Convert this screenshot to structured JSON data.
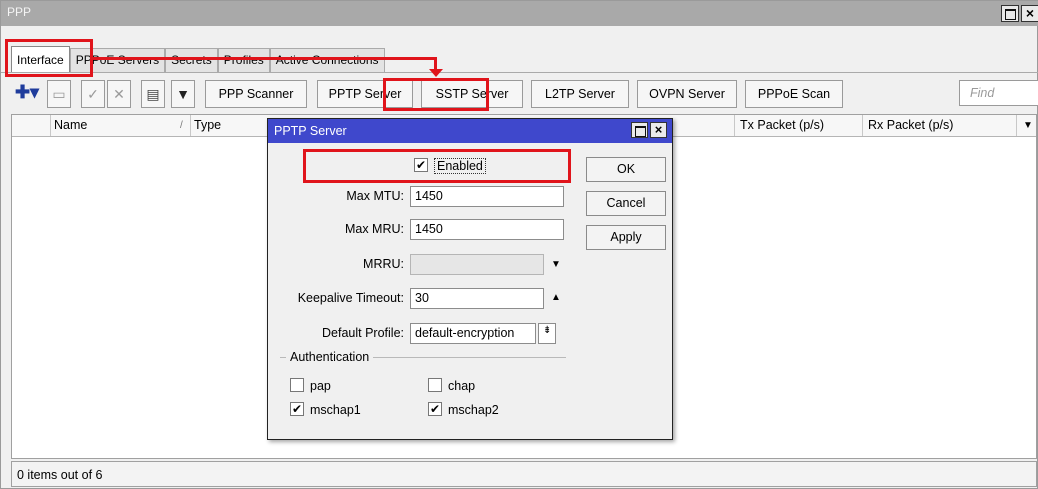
{
  "window": {
    "title": "PPP"
  },
  "tabs": [
    {
      "label": "Interface",
      "active": true
    },
    {
      "label": "PPPoE Servers",
      "active": false
    },
    {
      "label": "Secrets",
      "active": false
    },
    {
      "label": "Profiles",
      "active": false
    },
    {
      "label": "Active Connections",
      "active": false
    }
  ],
  "toolbar": {
    "icons": [
      "add-icon",
      "remove-icon",
      "enable-icon",
      "disable-icon",
      "comment-icon",
      "filter-icon"
    ],
    "buttons": [
      "PPP Scanner",
      "PPTP Server",
      "SSTP Server",
      "L2TP Server",
      "OVPN Server",
      "PPPoE Scan"
    ],
    "find_placeholder": "Find"
  },
  "table": {
    "columns": [
      "Name",
      "Type",
      "Tx Packet (p/s)",
      "Rx Packet (p/s)"
    ],
    "sort_marker": "/"
  },
  "status": "0 items out of 6",
  "dialog": {
    "title": "PPTP Server",
    "enabled_label": "Enabled",
    "enabled": true,
    "fields": {
      "max_mtu": {
        "label": "Max MTU:",
        "value": "1450"
      },
      "max_mru": {
        "label": "Max MRU:",
        "value": "1450"
      },
      "mrru": {
        "label": "MRRU:",
        "value": ""
      },
      "keepalive": {
        "label": "Keepalive Timeout:",
        "value": "30"
      },
      "default_profile": {
        "label": "Default Profile:",
        "value": "default-encryption"
      }
    },
    "auth_group": "Authentication",
    "auth": [
      {
        "label": "pap",
        "checked": false
      },
      {
        "label": "chap",
        "checked": false
      },
      {
        "label": "mschap1",
        "checked": true
      },
      {
        "label": "mschap2",
        "checked": true
      }
    ],
    "buttons": {
      "ok": "OK",
      "cancel": "Cancel",
      "apply": "Apply"
    }
  },
  "colors": {
    "highlight": "#e0141b",
    "dialog_title": "#3f48cc",
    "window_title": "#a9a9a9"
  }
}
